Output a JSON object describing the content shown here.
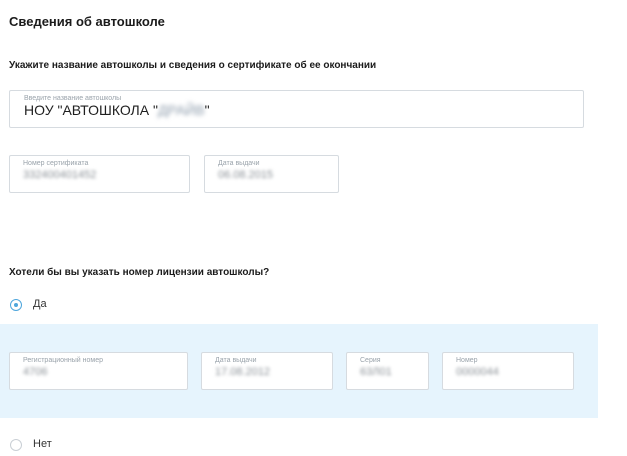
{
  "section": {
    "title": "Сведения об автошколе",
    "subtitle": "Укажите название автошколы и сведения о сертификате об ее окончании"
  },
  "school": {
    "label": "Введите название автошколы",
    "value_prefix": "НОУ \"АВТОШКОЛА \"",
    "value_hidden": "ДРАЙВ",
    "value_suffix": "\""
  },
  "certificate": {
    "number_label": "Номер сертификата",
    "number_value": "332400401452",
    "date_label": "Дата выдачи",
    "date_value": "06.08.2015"
  },
  "license": {
    "question": "Хотели бы вы указать номер лицензии автошколы?",
    "yes_label": "Да",
    "no_label": "Нет",
    "selected": "yes",
    "reg_label": "Регистрационный номер",
    "reg_value": "4706",
    "issue_label": "Дата выдачи",
    "issue_value": "17.08.2012",
    "series_label": "Серия",
    "series_value": "63Л01",
    "number_label": "Номер",
    "number_value": "0000044"
  },
  "colors": {
    "accent": "#4ea6dc",
    "panel_bg": "#e6f4fd",
    "border": "#d6dbe0"
  }
}
